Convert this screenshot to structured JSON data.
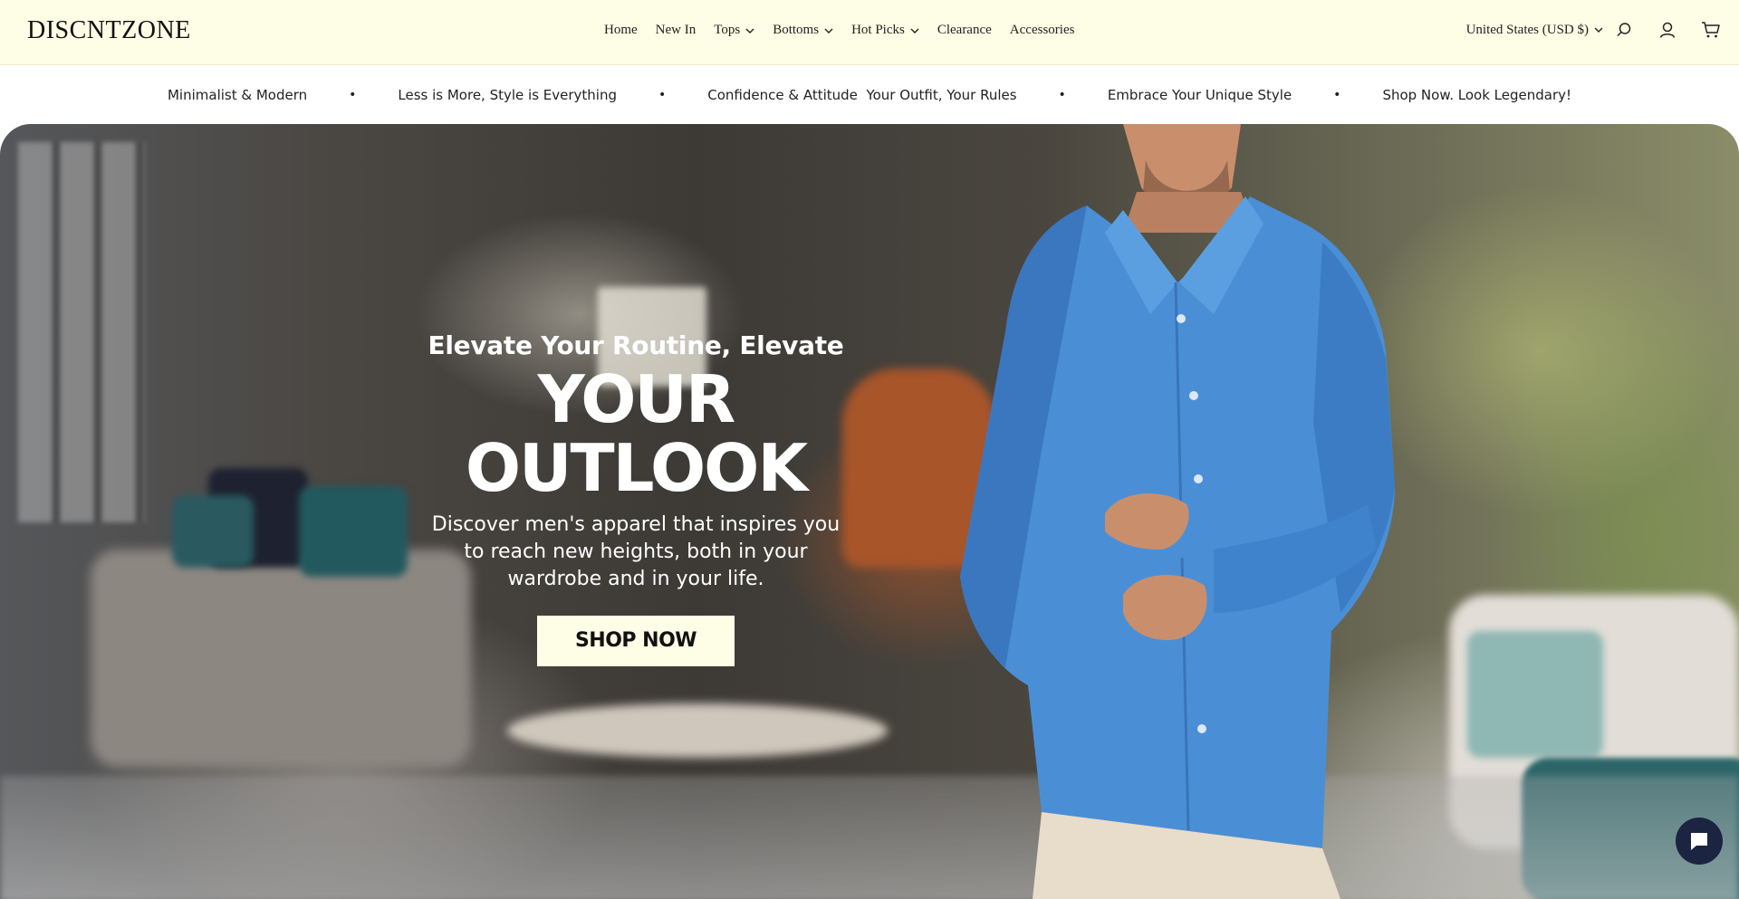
{
  "header": {
    "logo": "DISCNTZONE",
    "nav": [
      {
        "label": "Home",
        "dropdown": false
      },
      {
        "label": "New In",
        "dropdown": false
      },
      {
        "label": "Tops",
        "dropdown": true
      },
      {
        "label": "Bottoms",
        "dropdown": true
      },
      {
        "label": "Hot Picks",
        "dropdown": true
      },
      {
        "label": "Clearance",
        "dropdown": false
      },
      {
        "label": "Accessories",
        "dropdown": false
      }
    ],
    "locale": "United States (USD $)",
    "icons": [
      "search-icon",
      "account-icon",
      "cart-icon"
    ]
  },
  "marquee": [
    "Minimalist & Modern",
    "Less is More, Style is Everything",
    "Confidence & Attitude  Your Outfit, Your Rules",
    "Embrace Your Unique Style",
    "Shop Now. Look Legendary!"
  ],
  "marquee_separator": "•",
  "hero": {
    "kicker": "Elevate Your Routine, Elevate",
    "headline": "YOUR OUTLOOK",
    "subtitle": "Discover men's apparel that inspires you to reach new heights, both in your wardrobe and in your life.",
    "cta": "SHOP NOW"
  },
  "colors": {
    "header_bg": "#fefde5",
    "cta_bg": "#fefde5",
    "chat_bg": "#1b2440",
    "shirt": "#4a8fd6"
  }
}
